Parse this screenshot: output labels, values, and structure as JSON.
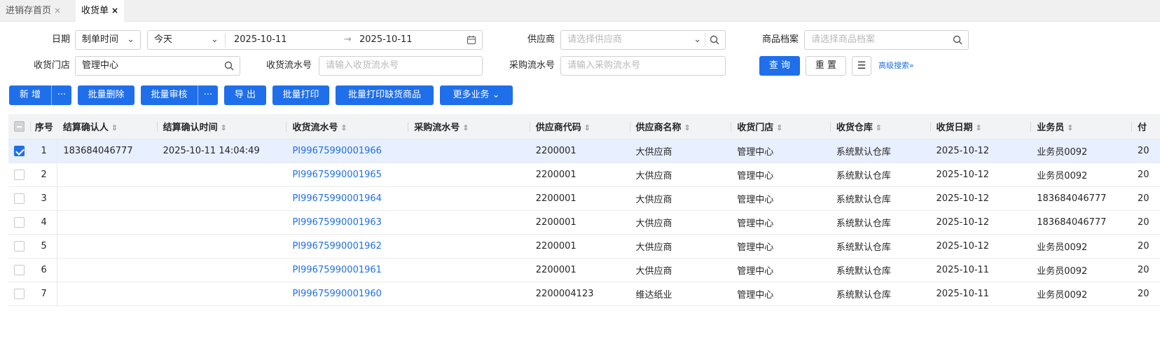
{
  "tabs": [
    {
      "label": "进销存首页",
      "close": "×"
    },
    {
      "label": "收货单",
      "close": "×"
    }
  ],
  "filters": {
    "date_label": "日期",
    "date_type": "制单时间",
    "date_range": "今天",
    "date_from": "2025-10-11",
    "date_sep": "→",
    "date_to": "2025-10-11",
    "supplier_label": "供应商",
    "supplier_placeholder": "请选择供应商",
    "product_label": "商品档案",
    "product_placeholder": "请选择商品档案",
    "store_label": "收货门店",
    "store_value": "管理中心",
    "receipt_no_label": "收货流水号",
    "receipt_no_placeholder": "请输入收货流水号",
    "purchase_no_label": "采购流水号",
    "purchase_no_placeholder": "请输入采购流水号",
    "query_btn": "查 询",
    "reset_btn": "重 置",
    "advanced": "高级搜索"
  },
  "toolbar": {
    "add": "新 增",
    "more_dots": "···",
    "batch_delete": "批量删除",
    "batch_audit": "批量审核",
    "export": "导 出",
    "batch_print": "批量打印",
    "batch_print_missing": "批量打印缺货商品",
    "more_business": "更多业务"
  },
  "table": {
    "headers": {
      "seq": "序号",
      "confirm_person": "结算确认人",
      "confirm_time": "结算确认时间",
      "receipt_no": "收货流水号",
      "purchase_no": "采购流水号",
      "supplier_code": "供应商代码",
      "supplier_name": "供应商名称",
      "store": "收货门店",
      "warehouse": "收货仓库",
      "date": "收货日期",
      "clerk": "业务员",
      "pay": "付"
    },
    "rows": [
      {
        "seq": "1",
        "confirm_person": "183684046777",
        "confirm_time": "2025-10-11 14:04:49",
        "receipt_no": "PI99675990001966",
        "purchase_no": "",
        "supplier_code": "2200001",
        "supplier_name": "大供应商",
        "store": "管理中心",
        "warehouse": "系统默认仓库",
        "date": "2025-10-12",
        "clerk": "业务员0092",
        "pay": "20"
      },
      {
        "seq": "2",
        "confirm_person": "",
        "confirm_time": "",
        "receipt_no": "PI99675990001965",
        "purchase_no": "",
        "supplier_code": "2200001",
        "supplier_name": "大供应商",
        "store": "管理中心",
        "warehouse": "系统默认仓库",
        "date": "2025-10-12",
        "clerk": "业务员0092",
        "pay": "20"
      },
      {
        "seq": "3",
        "confirm_person": "",
        "confirm_time": "",
        "receipt_no": "PI99675990001964",
        "purchase_no": "",
        "supplier_code": "2200001",
        "supplier_name": "大供应商",
        "store": "管理中心",
        "warehouse": "系统默认仓库",
        "date": "2025-10-12",
        "clerk": "183684046777",
        "pay": "20"
      },
      {
        "seq": "4",
        "confirm_person": "",
        "confirm_time": "",
        "receipt_no": "PI99675990001963",
        "purchase_no": "",
        "supplier_code": "2200001",
        "supplier_name": "大供应商",
        "store": "管理中心",
        "warehouse": "系统默认仓库",
        "date": "2025-10-12",
        "clerk": "183684046777",
        "pay": "20"
      },
      {
        "seq": "5",
        "confirm_person": "",
        "confirm_time": "",
        "receipt_no": "PI99675990001962",
        "purchase_no": "",
        "supplier_code": "2200001",
        "supplier_name": "大供应商",
        "store": "管理中心",
        "warehouse": "系统默认仓库",
        "date": "2025-10-12",
        "clerk": "业务员0092",
        "pay": "20"
      },
      {
        "seq": "6",
        "confirm_person": "",
        "confirm_time": "",
        "receipt_no": "PI99675990001961",
        "purchase_no": "",
        "supplier_code": "2200001",
        "supplier_name": "大供应商",
        "store": "管理中心",
        "warehouse": "系统默认仓库",
        "date": "2025-10-11",
        "clerk": "业务员0092",
        "pay": "20"
      },
      {
        "seq": "7",
        "confirm_person": "",
        "confirm_time": "",
        "receipt_no": "PI99675990001960",
        "purchase_no": "",
        "supplier_code": "2200004123",
        "supplier_name": "维达纸业",
        "store": "管理中心",
        "warehouse": "系统默认仓库",
        "date": "2025-10-11",
        "clerk": "业务员0092",
        "pay": "20"
      }
    ]
  },
  "colors": {
    "primary": "#1f6feb",
    "header_bg": "#f2f3f5",
    "selected_row": "#e8effe"
  }
}
